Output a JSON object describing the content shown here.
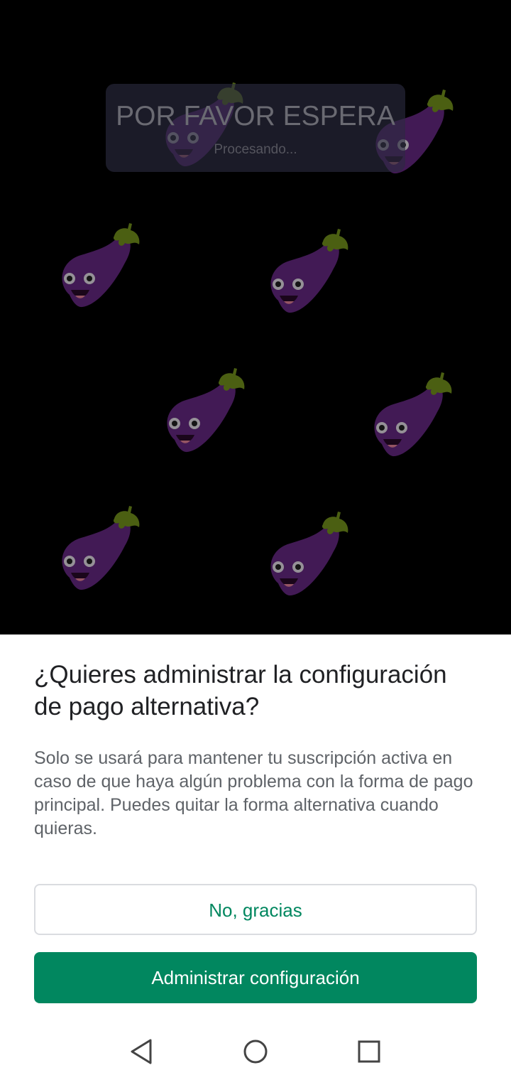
{
  "overlay": {
    "title": "POR FAVOR ESPERA",
    "subtitle": "Procesando..."
  },
  "background": {
    "decoration": "eggplant-icon pattern",
    "colors": {
      "eggplant": "#6b2a8a",
      "leaf": "#7a9a1e"
    }
  },
  "dialog": {
    "title": "¿Quieres administrar la configuración de pago alternativa?",
    "body": "Solo se usará para mantener tu suscripción activa en caso de que haya algún problema con la forma de pago principal. Puedes quitar la forma alternativa cuando quieras.",
    "secondary_button": "No, gracias",
    "primary_button": "Administrar configuración",
    "accent_color": "#01875f"
  },
  "navbar": {
    "back_icon": "back-triangle-icon",
    "home_icon": "home-circle-icon",
    "recents_icon": "recents-square-icon"
  }
}
